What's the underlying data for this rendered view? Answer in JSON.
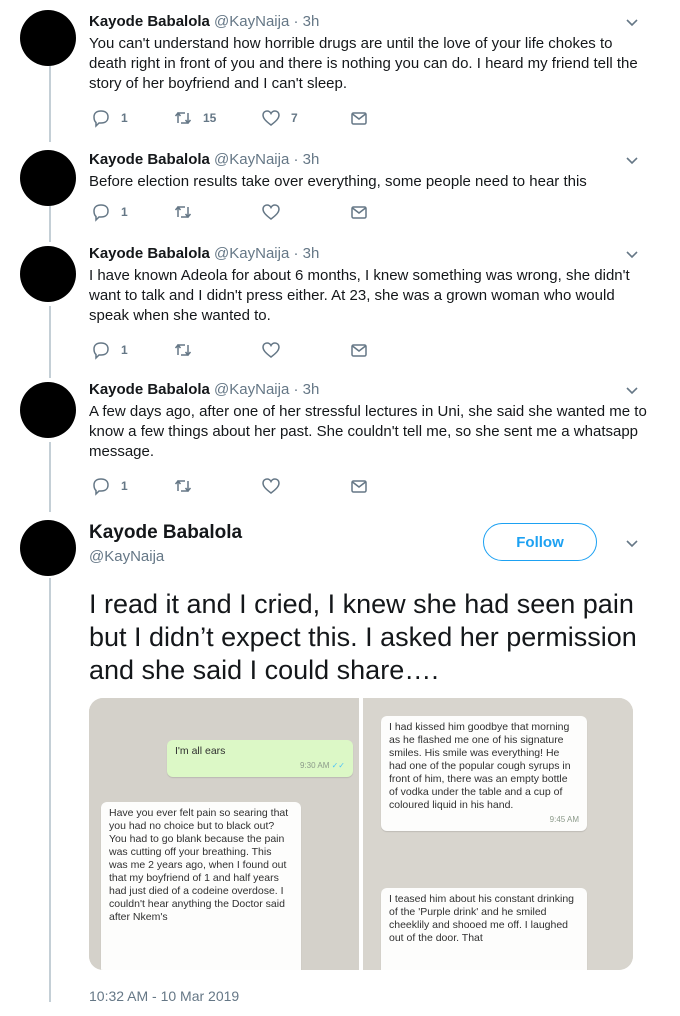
{
  "tweets": [
    {
      "name": "Kayode Babalola",
      "handle": "@KayNaija",
      "dot": "·",
      "time": "3h",
      "text": "You can't understand how horrible drugs are until the love of your life chokes to death right in front of you and there is nothing you can do. I heard my friend tell the story of her boyfriend and I can't sleep.",
      "replies": "1",
      "retweets": "15",
      "likes": "7"
    },
    {
      "name": "Kayode Babalola",
      "handle": "@KayNaija",
      "dot": "·",
      "time": "3h",
      "text": "Before election results take over everything, some people need to hear this",
      "replies": "1",
      "retweets": "",
      "likes": ""
    },
    {
      "name": "Kayode Babalola",
      "handle": "@KayNaija",
      "dot": "·",
      "time": "3h",
      "text": "I have known Adeola for about 6 months, I knew something was wrong, she didn't want to talk and I didn't press either. At 23, she was a grown woman who would speak when she wanted to.",
      "replies": "1",
      "retweets": "",
      "likes": ""
    },
    {
      "name": "Kayode Babalola",
      "handle": "@KayNaija",
      "dot": "·",
      "time": "3h",
      "text": "A few days ago, after one of her stressful lectures in Uni, she said she wanted me to know a few things about her past. She couldn't tell me, so she sent me a whatsapp message.",
      "replies": "1",
      "retweets": "",
      "likes": ""
    }
  ],
  "main_tweet": {
    "name": "Kayode Babalola",
    "handle": "@KayNaija",
    "follow_label": "Follow",
    "text": "I read it and I cried, I knew she had seen pain but I didn’t expect this. I asked her permission and she said I could share….",
    "timestamp": "10:32 AM - 10 Mar 2019"
  },
  "media": {
    "left": {
      "outgoing_text": "I'm all ears",
      "outgoing_time": "9:30 AM",
      "incoming_text": "Have you ever felt pain so searing that you had no choice but to black out? You had to go blank because the pain was cutting off your breathing. This was me 2 years ago, when I found out that my boyfriend of 1 and half years had just died of a codeine overdose. I couldn't hear anything the Doctor said after Nkem's"
    },
    "right": {
      "msg1_text": "I had kissed him goodbye that morning as he flashed me one of his signature smiles. His smile was everything! He had one of the popular cough syrups in front of him, there was an empty bottle of vodka under the table and a cup of coloured liquid in his hand.",
      "msg1_time": "9:45 AM",
      "msg2_text": "I teased him about his constant drinking of the 'Purple drink' and he smiled cheeklily and shooed me off. I laughed out of the door. That"
    }
  },
  "icons": {
    "reply": "reply-icon",
    "retweet": "retweet-icon",
    "like": "heart-icon",
    "dm": "envelope-icon",
    "caret": "chevron-down-icon"
  },
  "colors": {
    "accent": "#1da1f2",
    "muted": "#657786",
    "thread_line": "#c4cfd6"
  }
}
